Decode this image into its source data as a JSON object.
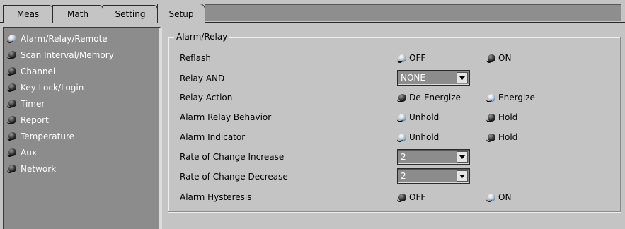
{
  "tabs": [
    {
      "label": "Meas",
      "icon": "",
      "active": false
    },
    {
      "label": "Math",
      "active": false
    },
    {
      "label": "Setting",
      "active": false
    },
    {
      "label": "Setup",
      "active": true
    }
  ],
  "sidebar": {
    "items": [
      {
        "label": "Alarm/Relay/Remote",
        "selected": true
      },
      {
        "label": "Scan Interval/Memory",
        "selected": false
      },
      {
        "label": "Channel",
        "selected": false
      },
      {
        "label": "Key Lock/Login",
        "selected": false
      },
      {
        "label": "Timer",
        "selected": false
      },
      {
        "label": "Report",
        "selected": false
      },
      {
        "label": "Temperature",
        "selected": false
      },
      {
        "label": "Aux",
        "selected": false
      },
      {
        "label": "Network",
        "selected": false
      }
    ]
  },
  "group": {
    "title": "Alarm/Relay",
    "rows": [
      {
        "label": "Reflash",
        "type": "radio",
        "options": [
          "OFF",
          "ON"
        ],
        "selected": "OFF"
      },
      {
        "label": "Relay AND",
        "type": "select",
        "value": "NONE"
      },
      {
        "label": "Relay Action",
        "type": "radio",
        "options": [
          "De-Energize",
          "Energize"
        ],
        "selected": "Energize"
      },
      {
        "label": "Alarm Relay Behavior",
        "type": "radio",
        "options": [
          "Unhold",
          "Hold"
        ],
        "selected": "Unhold"
      },
      {
        "label": "Alarm Indicator",
        "type": "radio",
        "options": [
          "Unhold",
          "Hold"
        ],
        "selected": "Unhold"
      },
      {
        "label": "Rate of Change Increase",
        "type": "select",
        "value": "2"
      },
      {
        "label": "Rate of Change Decrease",
        "type": "select",
        "value": "2"
      },
      {
        "label": "Alarm Hysteresis",
        "type": "radio",
        "options": [
          "OFF",
          "ON"
        ],
        "selected": "ON"
      }
    ]
  },
  "colors": {
    "window_bg": "#c4c4c4",
    "sidebar_bg": "#8c8c8c",
    "radio_on": "#6a9cbc",
    "radio_off": "#2a2a2a"
  }
}
